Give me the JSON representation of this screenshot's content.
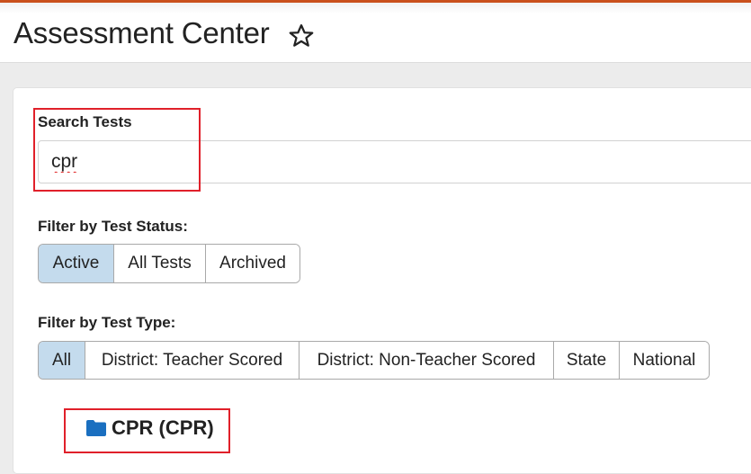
{
  "header": {
    "title": "Assessment Center",
    "favorite_icon": "star-outline-icon",
    "accent_color": "#c9501c"
  },
  "search": {
    "label": "Search Tests",
    "value": "cpr",
    "placeholder": ""
  },
  "status_filter": {
    "label": "Filter by Test Status:",
    "options": [
      {
        "label": "Active",
        "selected": true
      },
      {
        "label": "All Tests",
        "selected": false
      },
      {
        "label": "Archived",
        "selected": false
      }
    ]
  },
  "type_filter": {
    "label": "Filter by Test Type:",
    "options": [
      {
        "label": "All",
        "selected": true
      },
      {
        "label": "District: Teacher Scored",
        "selected": false
      },
      {
        "label": "District: Non-Teacher Scored",
        "selected": false
      },
      {
        "label": "State",
        "selected": false
      },
      {
        "label": "National",
        "selected": false
      }
    ]
  },
  "results": [
    {
      "icon": "folder-icon",
      "label": "CPR (CPR)",
      "icon_color": "#1a6fc0"
    }
  ],
  "annotations": {
    "highlight_color": "#e0202a"
  }
}
